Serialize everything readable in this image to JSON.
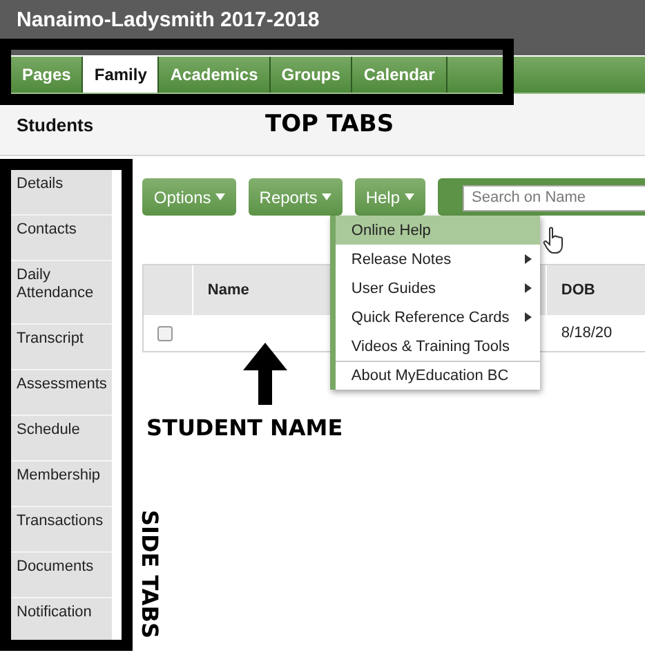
{
  "header": {
    "title": "Nanaimo-Ladysmith 2017-2018"
  },
  "top_tabs": [
    {
      "label": "Pages",
      "selected": false
    },
    {
      "label": "Family",
      "selected": true
    },
    {
      "label": "Academics",
      "selected": false
    },
    {
      "label": "Groups",
      "selected": false
    },
    {
      "label": "Calendar",
      "selected": false
    }
  ],
  "page_title": "Students",
  "side_tabs": [
    "Details",
    "Contacts",
    "Daily Attendance",
    "Transcript",
    "Assessments",
    "Schedule",
    "Membership",
    "Transactions",
    "Documents",
    "Notification"
  ],
  "toolbar": {
    "buttons": [
      "Options",
      "Reports",
      "Help"
    ],
    "search": {
      "placeholder": "Search on Name"
    }
  },
  "table": {
    "columns": [
      "Name",
      "DOB"
    ],
    "rows": [
      {
        "checked": false,
        "dob": "8/18/20"
      }
    ]
  },
  "help_menu": {
    "items": [
      {
        "label": "Online Help",
        "selected": true,
        "has_submenu": false,
        "divider_above": false
      },
      {
        "label": "Release Notes",
        "selected": false,
        "has_submenu": true,
        "divider_above": false
      },
      {
        "label": "User Guides",
        "selected": false,
        "has_submenu": true,
        "divider_above": false
      },
      {
        "label": "Quick Reference Cards",
        "selected": false,
        "has_submenu": true,
        "divider_above": false
      },
      {
        "label": "Videos & Training Tools",
        "selected": false,
        "has_submenu": false,
        "divider_above": false
      },
      {
        "label": "About MyEducation BC",
        "selected": false,
        "has_submenu": false,
        "divider_above": true
      }
    ]
  },
  "annotations": {
    "top_tabs_label": "TOP TABS",
    "student_name_label": "STUDENT NAME",
    "side_tabs_label": "SIDE TABS"
  }
}
